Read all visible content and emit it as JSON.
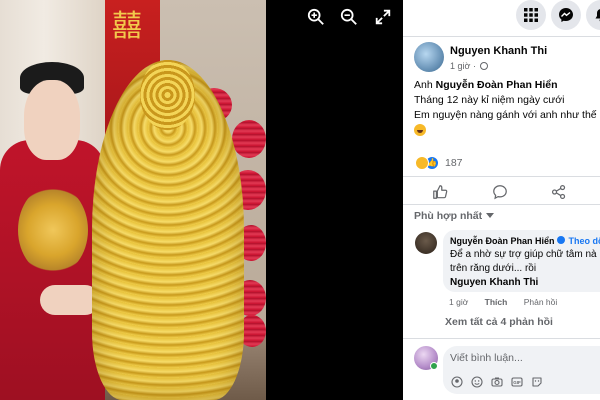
{
  "viewer": {
    "zoom_in_icon": "zoom-in-icon",
    "zoom_out_icon": "zoom-out-icon",
    "fullscreen_icon": "fullscreen-icon",
    "decoration_text": "囍"
  },
  "topbar": {
    "icons": [
      "grid-menu-icon",
      "messenger-icon",
      "bell-icon"
    ]
  },
  "post": {
    "author": "Nguyen Khanh Thi",
    "time": "1 giờ",
    "privacy_icon": "globe-icon",
    "lines": {
      "line1_prefix": "Anh",
      "line1_mention": "Nguyễn Đoàn Phan Hiển",
      "line2": "Tháng 12 này kỉ niệm ngày cưới",
      "line3": "Em nguyện nàng gánh với anh như thế nà"
    },
    "reaction_count": "187"
  },
  "actions": [
    "like-icon",
    "comment-icon",
    "share-icon"
  ],
  "comments": {
    "sort_label": "Phù hợp nhất",
    "items": [
      {
        "author": "Nguyễn Đoàn Phan Hiển",
        "follow_label": "Theo dõ",
        "text1": "Để a nhờ sự trợ giúp chữ tâm nà",
        "text2": "trên răng dưới... rồi",
        "mention": "Nguyen Khanh Thi",
        "time": "1 giờ",
        "like_label": "Thích",
        "reply_label": "Phản hồi"
      }
    ],
    "view_all": "Xem tất cả 4 phản hồi",
    "input_placeholder": "Viết bình luận...",
    "input_icons": [
      "avatar-sticker-icon",
      "emoji-icon",
      "camera-icon",
      "gif-icon",
      "sticker-icon"
    ]
  },
  "colors": {
    "accent": "#1877f2",
    "text_secondary": "#65676b",
    "bubble": "#f0f2f5"
  }
}
